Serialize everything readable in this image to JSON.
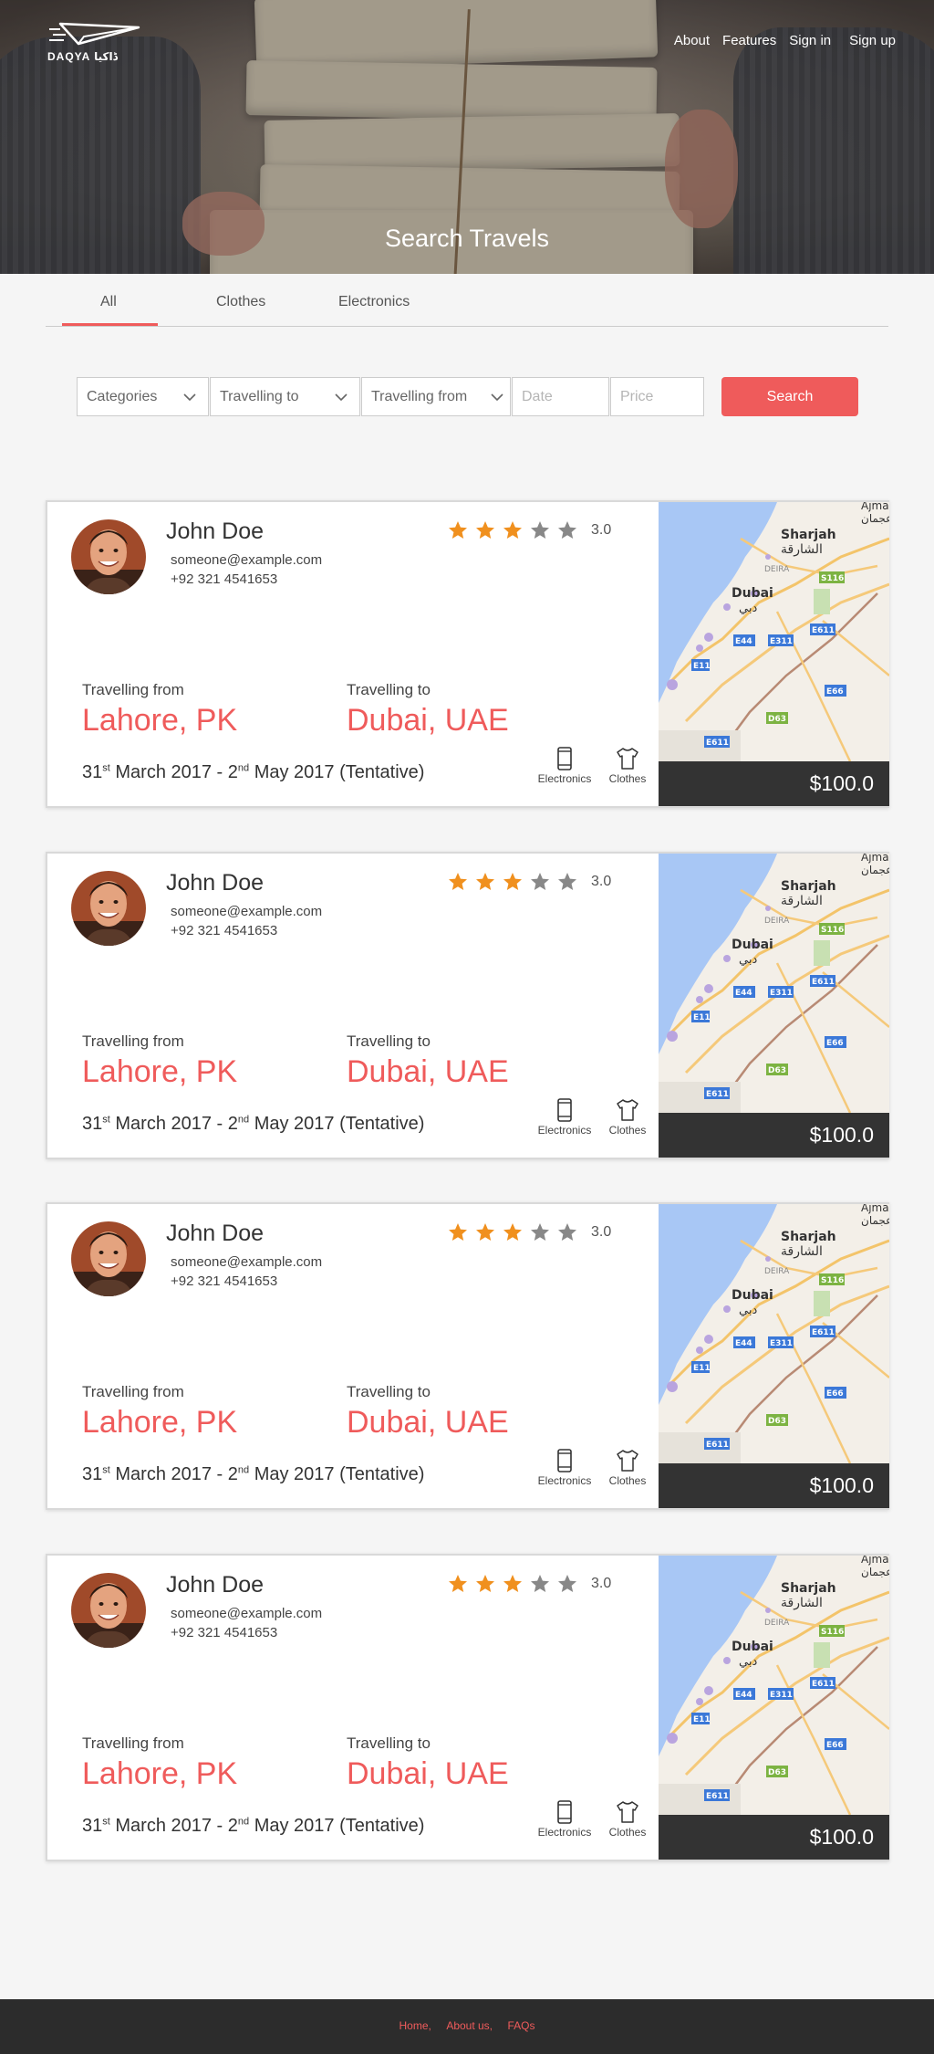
{
  "brand": {
    "name": "DAQYA ڈاکیا"
  },
  "nav": [
    "About",
    "Features",
    "Sign in",
    "Sign up"
  ],
  "hero": {
    "title": "Search Travels"
  },
  "tabs": [
    "All",
    "Clothes",
    "Electronics"
  ],
  "filters": {
    "categories": "Categories",
    "travelling_to": "Travelling to",
    "travelling_from": "Travelling from",
    "date_placeholder": "Date",
    "price_placeholder": "Price",
    "search_label": "Search"
  },
  "cards": [
    {
      "name": "John Doe",
      "email": "someone@example.com",
      "phone": "+92 321 4541653",
      "rating": "3.0",
      "stars": 3,
      "from_label": "Travelling from",
      "from": "Lahore, PK",
      "to_label": "Travelling to",
      "to": "Dubai, UAE",
      "date_start": "31",
      "date_start_sup": "st",
      "date_start_rest": " March 2017 - 2",
      "date_end_sup": "nd",
      "date_end_rest": " May 2017 (Tentative)",
      "cat1": "Electronics",
      "cat2": "Clothes",
      "price": "$100.0"
    },
    {
      "name": "John Doe",
      "email": "someone@example.com",
      "phone": "+92 321 4541653",
      "rating": "3.0",
      "stars": 3,
      "from_label": "Travelling from",
      "from": "Lahore, PK",
      "to_label": "Travelling to",
      "to": "Dubai, UAE",
      "date_start": "31",
      "date_start_sup": "st",
      "date_start_rest": " March 2017 - 2",
      "date_end_sup": "nd",
      "date_end_rest": " May 2017 (Tentative)",
      "cat1": "Electronics",
      "cat2": "Clothes",
      "price": "$100.0"
    },
    {
      "name": "John Doe",
      "email": "someone@example.com",
      "phone": "+92 321 4541653",
      "rating": "3.0",
      "stars": 3,
      "from_label": "Travelling from",
      "from": "Lahore, PK",
      "to_label": "Travelling to",
      "to": "Dubai, UAE",
      "date_start": "31",
      "date_start_sup": "st",
      "date_start_rest": " March 2017 - 2",
      "date_end_sup": "nd",
      "date_end_rest": " May 2017 (Tentative)",
      "cat1": "Electronics",
      "cat2": "Clothes",
      "price": "$100.0"
    },
    {
      "name": "John Doe",
      "email": "someone@example.com",
      "phone": "+92 321 4541653",
      "rating": "3.0",
      "stars": 3,
      "from_label": "Travelling from",
      "from": "Lahore, PK",
      "to_label": "Travelling to",
      "to": "Dubai, UAE",
      "date_start": "31",
      "date_start_sup": "st",
      "date_start_rest": " March 2017 - 2",
      "date_end_sup": "nd",
      "date_end_rest": " May 2017 (Tentative)",
      "cat1": "Electronics",
      "cat2": "Clothes",
      "price": "$100.0"
    }
  ],
  "map_labels": {
    "ajman_en": "Ajman",
    "ajman_ar": "عجمان",
    "sharjah_en": "Sharjah",
    "sharjah_ar": "الشارقة",
    "dubai_en": "Dubai",
    "dubai_ar": "دبي",
    "deira": "DEIRA",
    "roads": [
      "S116",
      "E44",
      "E311",
      "E611",
      "E11",
      "E66",
      "D63",
      "E611"
    ]
  },
  "footer": [
    "Home,",
    "About us,",
    "FAQs"
  ],
  "colors": {
    "accent": "#ef5b5b",
    "star": "#f0901e",
    "star_empty": "#888888",
    "dark": "#333333"
  }
}
